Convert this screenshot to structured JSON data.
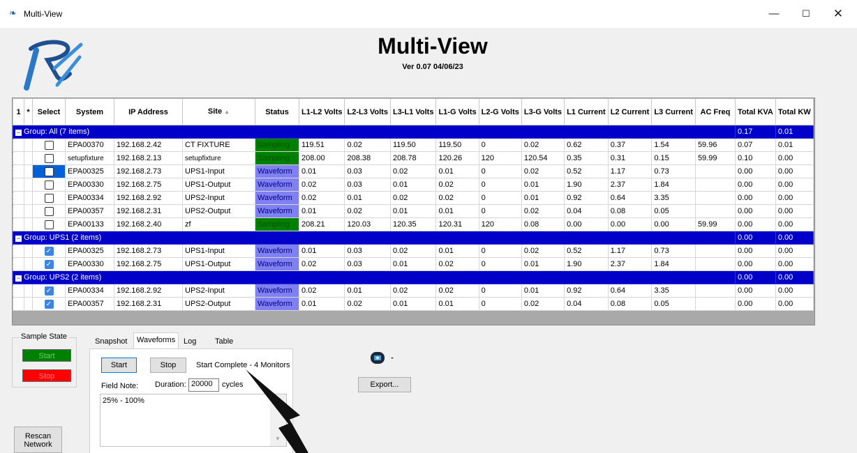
{
  "window": {
    "title": "Multi-View",
    "minimize": "—",
    "maximize": "☐",
    "close": "✕"
  },
  "header": {
    "title": "Multi-View",
    "version": "Ver 0.07 04/06/23"
  },
  "grid": {
    "corner": "1",
    "columns": [
      "Select",
      "System",
      "IP Address",
      "Site",
      "Status",
      "L1-L2 Volts",
      "L2-L3 Volts",
      "L3-L1 Volts",
      "L1-G Volts",
      "L2-G Volts",
      "L3-G Volts",
      "L1 Current",
      "L2 Current",
      "L3 Current",
      "AC Freq",
      "Total KVA",
      "Total KW"
    ],
    "groups": [
      {
        "label": "Group: All (7 items)",
        "total_kva": "0.17",
        "total_kw": "0.01",
        "rows": [
          {
            "selected": false,
            "system": "EPA00370",
            "ip": "192.168.2.42",
            "site": "CT FIXTURE",
            "status": "Sampling",
            "v12": "119.51",
            "v23": "0.02",
            "v31": "119.50",
            "v1g": "119.50",
            "v2g": "0",
            "v3g": "0.02",
            "i1": "0.62",
            "i2": "0.37",
            "i3": "1.54",
            "freq": "59.96",
            "kva": "0.07",
            "kw": "0.01"
          },
          {
            "selected": false,
            "system": "setupfixture",
            "ip": "192.168.2.13",
            "site": "setupfixture",
            "status": "Sampling",
            "v12": "208.00",
            "v23": "208.38",
            "v31": "208.78",
            "v1g": "120.26",
            "v2g": "120",
            "v3g": "120.54",
            "i1": "0.35",
            "i2": "0.31",
            "i3": "0.15",
            "freq": "59.99",
            "kva": "0.10",
            "kw": "0.00"
          },
          {
            "selected": false,
            "system": "EPA00325",
            "ip": "192.168.2.73",
            "site": "UPS1-Input",
            "status": "Waveform",
            "v12": "0.01",
            "v23": "0.03",
            "v31": "0.02",
            "v1g": "0.01",
            "v2g": "0",
            "v3g": "0.02",
            "i1": "0.52",
            "i2": "1.17",
            "i3": "0.73",
            "freq": "",
            "kva": "0.00",
            "kw": "0.00",
            "rowsel": true
          },
          {
            "selected": false,
            "system": "EPA00330",
            "ip": "192.168.2.75",
            "site": "UPS1-Output",
            "status": "Waveform",
            "v12": "0.02",
            "v23": "0.03",
            "v31": "0.01",
            "v1g": "0.02",
            "v2g": "0",
            "v3g": "0.01",
            "i1": "1.90",
            "i2": "2.37",
            "i3": "1.84",
            "freq": "",
            "kva": "0.00",
            "kw": "0.00"
          },
          {
            "selected": false,
            "system": "EPA00334",
            "ip": "192.168.2.92",
            "site": "UPS2-Input",
            "status": "Waveform",
            "v12": "0.02",
            "v23": "0.01",
            "v31": "0.02",
            "v1g": "0.02",
            "v2g": "0",
            "v3g": "0.01",
            "i1": "0.92",
            "i2": "0.64",
            "i3": "3.35",
            "freq": "",
            "kva": "0.00",
            "kw": "0.00"
          },
          {
            "selected": false,
            "system": "EPA00357",
            "ip": "192.168.2.31",
            "site": "UPS2-Output",
            "status": "Waveform",
            "v12": "0.01",
            "v23": "0.02",
            "v31": "0.01",
            "v1g": "0.01",
            "v2g": "0",
            "v3g": "0.02",
            "i1": "0.04",
            "i2": "0.08",
            "i3": "0.05",
            "freq": "",
            "kva": "0.00",
            "kw": "0.00"
          },
          {
            "selected": false,
            "system": "EPA00133",
            "ip": "192.168.2.40",
            "site": "zf",
            "status": "Sampling",
            "v12": "208.21",
            "v23": "120.03",
            "v31": "120.35",
            "v1g": "120.31",
            "v2g": "120",
            "v3g": "0.08",
            "i1": "0.00",
            "i2": "0.00",
            "i3": "0.00",
            "freq": "59.99",
            "kva": "0.00",
            "kw": "0.00"
          }
        ]
      },
      {
        "label": "Group: UPS1 (2 items)",
        "total_kva": "0.00",
        "total_kw": "0.00",
        "rows": [
          {
            "selected": true,
            "system": "EPA00325",
            "ip": "192.168.2.73",
            "site": "UPS1-Input",
            "status": "Waveform",
            "v12": "0.01",
            "v23": "0.03",
            "v31": "0.02",
            "v1g": "0.01",
            "v2g": "0",
            "v3g": "0.02",
            "i1": "0.52",
            "i2": "1.17",
            "i3": "0.73",
            "freq": "",
            "kva": "0.00",
            "kw": "0.00"
          },
          {
            "selected": true,
            "system": "EPA00330",
            "ip": "192.168.2.75",
            "site": "UPS1-Output",
            "status": "Waveform",
            "v12": "0.02",
            "v23": "0.03",
            "v31": "0.01",
            "v1g": "0.02",
            "v2g": "0",
            "v3g": "0.01",
            "i1": "1.90",
            "i2": "2.37",
            "i3": "1.84",
            "freq": "",
            "kva": "0.00",
            "kw": "0.00"
          }
        ]
      },
      {
        "label": "Group: UPS2 (2 items)",
        "total_kva": "0.00",
        "total_kw": "0.00",
        "rows": [
          {
            "selected": true,
            "system": "EPA00334",
            "ip": "192.168.2.92",
            "site": "UPS2-Input",
            "status": "Waveform",
            "v12": "0.02",
            "v23": "0.01",
            "v31": "0.02",
            "v1g": "0.02",
            "v2g": "0",
            "v3g": "0.01",
            "i1": "0.92",
            "i2": "0.64",
            "i3": "3.35",
            "freq": "",
            "kva": "0.00",
            "kw": "0.00"
          },
          {
            "selected": true,
            "system": "EPA00357",
            "ip": "192.168.2.31",
            "site": "UPS2-Output",
            "status": "Waveform",
            "v12": "0.01",
            "v23": "0.02",
            "v31": "0.01",
            "v1g": "0.01",
            "v2g": "0",
            "v3g": "0.02",
            "i1": "0.04",
            "i2": "0.08",
            "i3": "0.05",
            "freq": "",
            "kva": "0.00",
            "kw": "0.00"
          }
        ]
      }
    ]
  },
  "sample_state": {
    "label": "Sample State",
    "start": "Start",
    "stop": "Stop"
  },
  "rescan_button": "Rescan Network",
  "tabs": [
    "Snapshot",
    "Waveforms",
    "Log",
    "Table"
  ],
  "active_tab": "Waveforms",
  "waveforms": {
    "start": "Start",
    "stop": "Stop",
    "status": "Start Complete - 4 Monitors",
    "field_note_label": "Field Note:",
    "duration_label": "Duration:",
    "duration_value": "20000",
    "cycles_label": "cycles",
    "note_text": "25% - 100%"
  },
  "export_button": "Export...",
  "icons": {
    "app": "rx-logo-icon",
    "camera": "camera-icon",
    "dropdown": "caret-down-icon"
  },
  "colors": {
    "group_row": "#0000c8",
    "sampling": "#008000",
    "waveform": "#8080f0",
    "start": "#008000",
    "stop": "#ff0000"
  }
}
